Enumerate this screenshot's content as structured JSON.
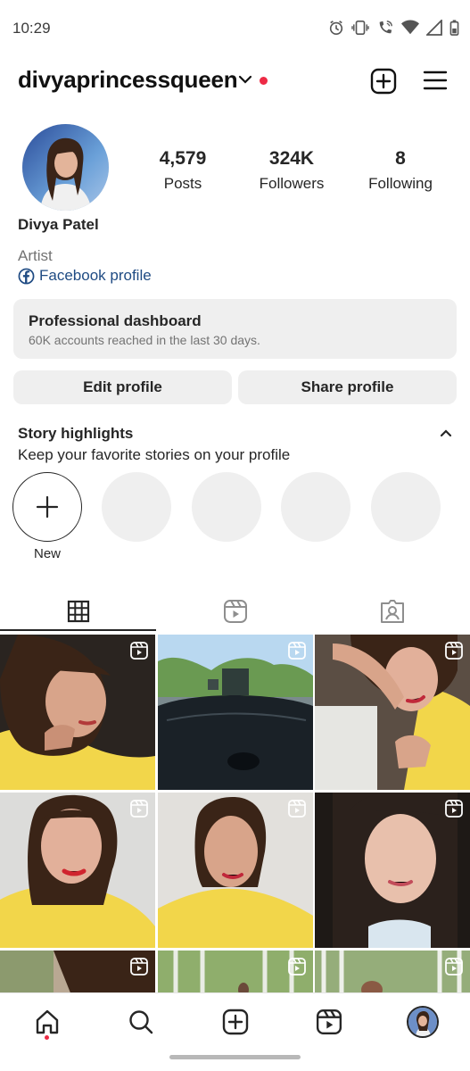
{
  "status_bar": {
    "time": "10:29",
    "icons": [
      "alarm-icon",
      "vibrate-icon",
      "wifi-calling-icon",
      "wifi-icon",
      "signal-icon",
      "battery-icon"
    ]
  },
  "header": {
    "username": "divyaprincessqueen",
    "notification_dot_color": "#ed2a45"
  },
  "profile": {
    "full_name": "Divya Patel",
    "category": "Artist",
    "facebook_link": "Facebook profile",
    "stats": [
      {
        "value": "4,579",
        "label": "Posts"
      },
      {
        "value": "324K",
        "label": "Followers"
      },
      {
        "value": "8",
        "label": "Following"
      }
    ]
  },
  "dashboard": {
    "title": "Professional dashboard",
    "subtitle": "60K accounts reached in the last 30 days."
  },
  "buttons": {
    "edit_profile": "Edit profile",
    "share_profile": "Share profile"
  },
  "highlights": {
    "title": "Story highlights",
    "subtitle": "Keep your favorite stories on your profile",
    "new_label": "New"
  },
  "tabs": [
    "grid-tab",
    "reels-tab",
    "tagged-tab"
  ],
  "grid": {
    "tiles": [
      {
        "type": "reel",
        "scene": "girl-yellow-top-looking-down"
      },
      {
        "type": "reel",
        "scene": "road-through-car-windshield"
      },
      {
        "type": "reel",
        "scene": "girl-lying-arm-over-head"
      },
      {
        "type": "reel",
        "scene": "girl-red-lips-yellow-top"
      },
      {
        "type": "reel",
        "scene": "girl-ponytail-yellow-top"
      },
      {
        "type": "reel",
        "scene": "girl-close-up-dark-hair"
      },
      {
        "type": "reel",
        "scene": "girl-outdoors-partial"
      },
      {
        "type": "reel",
        "scene": "trees-forest"
      },
      {
        "type": "reel",
        "scene": "trees-forest-girl"
      }
    ]
  },
  "bottom_nav": [
    "home-icon",
    "search-icon",
    "create-icon",
    "reels-icon",
    "profile-avatar"
  ],
  "colors": {
    "accent_red": "#ed2a45",
    "link_blue": "#1f4b83",
    "button_bg": "#efefef",
    "text": "#262626",
    "muted": "#737373"
  }
}
